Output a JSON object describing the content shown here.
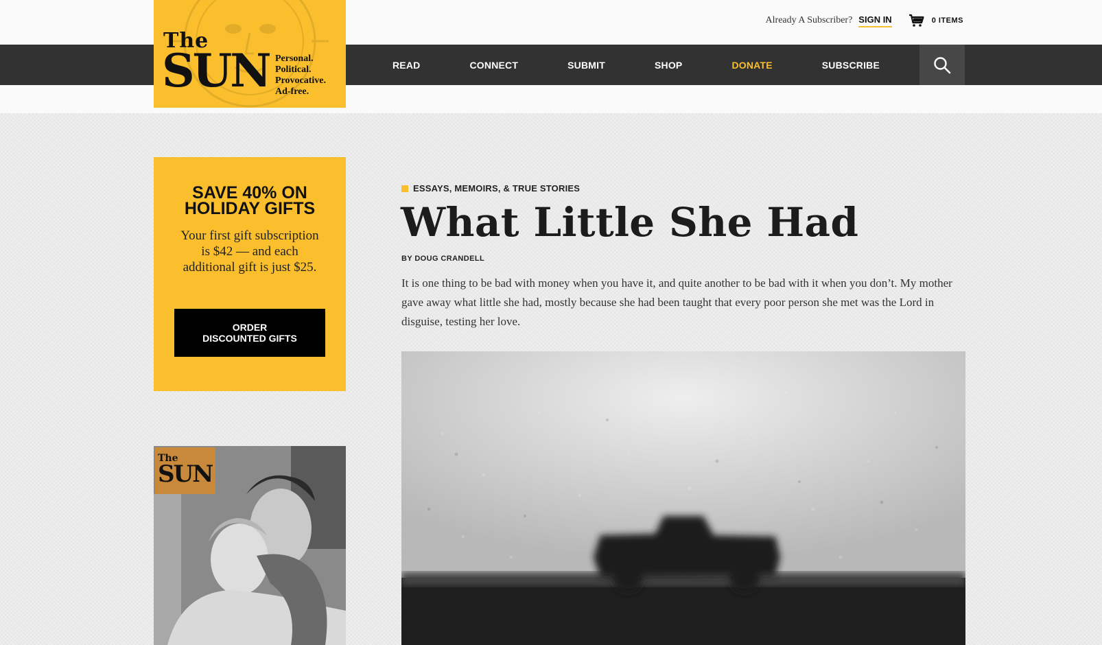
{
  "header": {
    "already_text": "Already A Subscriber?",
    "sign_in": "SIGN IN",
    "cart_items": "0 ITEMS"
  },
  "logo": {
    "the": "The",
    "sun": "SUN",
    "tagline": [
      "Personal.",
      "Political.",
      "Provocative.",
      "Ad-free."
    ]
  },
  "nav": {
    "items": [
      "READ",
      "CONNECT",
      "SUBMIT",
      "SHOP",
      "DONATE",
      "SUBSCRIBE"
    ],
    "accent_item": "DONATE"
  },
  "promo": {
    "headline_line1": "SAVE 40% ON",
    "headline_line2": "HOLIDAY GIFTS",
    "body": "Your first gift subscription is $42 — and each additional gift is just $25.",
    "button_line1": "ORDER",
    "button_line2": "DISCOUNTED GIFTS"
  },
  "cover": {
    "the": "The",
    "sun": "SUN"
  },
  "article": {
    "category": "ESSAYS, MEMOIRS, & TRUE STORIES",
    "title": "What Little She Had",
    "byline": "BY DOUG CRANDELL",
    "excerpt": "It is one thing to be bad with money when you have it, and quite another to be bad with it when you don’t. My mother gave away what little she had, mostly because she had been taught that every poor person she met was the Lord in disguise, testing her love."
  },
  "colors": {
    "accent": "#fbbf2e",
    "nav_bg": "#323232",
    "text": "#222222"
  },
  "icons": {
    "cart": "cart-icon",
    "search": "search-icon"
  }
}
